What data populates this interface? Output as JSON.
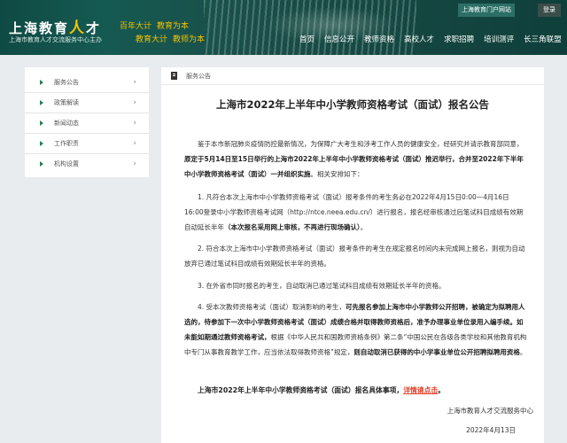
{
  "header": {
    "logo_main": "上海教育",
    "logo_accent": "人",
    "logo_end": "才",
    "logo_subtitle": "上海市教育人才交流服务中心主办",
    "slogans": [
      "百年大计",
      "教育为本",
      "教育大计",
      "教师为本"
    ],
    "portal_link": "上海教育门户网站",
    "login": "登录",
    "nav": [
      "首页",
      "信息公开",
      "教师资格",
      "高校人才",
      "求职招聘",
      "培训测评",
      "长三角联盟"
    ]
  },
  "sidebar": {
    "items": [
      {
        "label": "服务公告"
      },
      {
        "label": "政策解读"
      },
      {
        "label": "新闻动态"
      },
      {
        "label": "工作职责"
      },
      {
        "label": "机构设置"
      }
    ],
    "chevron": "›"
  },
  "breadcrumb": "服务公告",
  "article": {
    "title": "上海市2022年上半年中小学教师资格考试（面试）报名公告",
    "p0_a": "鉴于本市新冠肺炎疫情防控最新情况，为保障广大考生和涉考工作人员的健康安全，经研究并请示教育部同意，",
    "p0_b": "原定于5月14日至15日举行的上海市2022年上半年中小学教师资格考试（面试）推迟举行，合并至2022年下半年中小学教师资格考试（面试）一并组织实施",
    "p0_c": "。相关安排如下：",
    "p1_a": "1. 凡符合本次上海市中小学教师资格考试（面试）报考条件的考生务必在2022年4月15日0:00—4月16日16:00登录中小学教师资格考试网（http://ntce.neea.edu.cn/）进行报名，报名经审核通过后笔试科目成绩有效期自动延长半年",
    "p1_b": "（本次报名采用网上审核，不再进行现场确认）",
    "p1_c": "。",
    "p2": "2. 符合本次上海市中小学教师资格考试（面试）报考条件的考生在规定报名时间内未完成网上报名，则视为自动放弃已通过笔试科目成绩有效期延长半年的资格。",
    "p3": "3. 在外省市同时报名的考生，自动取消已通过笔试科目成绩有效期延长半年的资格。",
    "p4_a": "4. 受本次教师资格考试（面试）取消影响的考生，",
    "p4_b": "可先报名参加上海市中小学教师公开招聘，被确定为拟聘用人选的，待参加下一次中小学教师资格考试（面试）成绩合格并取得教师资格后，准予办理事业单位录用入编手续。如未能如期通过教师资格考试，",
    "p4_c": "根据《中华人民共和国教师资格条例》第二条“中国公民在各级各类学校和其他教育机构中专门从事教育教学工作，应当依法取得教师资格”规定，",
    "p4_d": "则自动取消已获得的中小学事业单位公开招聘拟聘用资格",
    "p4_e": "。",
    "p5_a": "上海市2022年上半年中小学教师资格考试（面试）报名具体事项，",
    "p5_link": "详情请点击",
    "p5_b": "。",
    "signature": "上海市教育人才交流服务中心",
    "date": "2022年4月13日"
  }
}
